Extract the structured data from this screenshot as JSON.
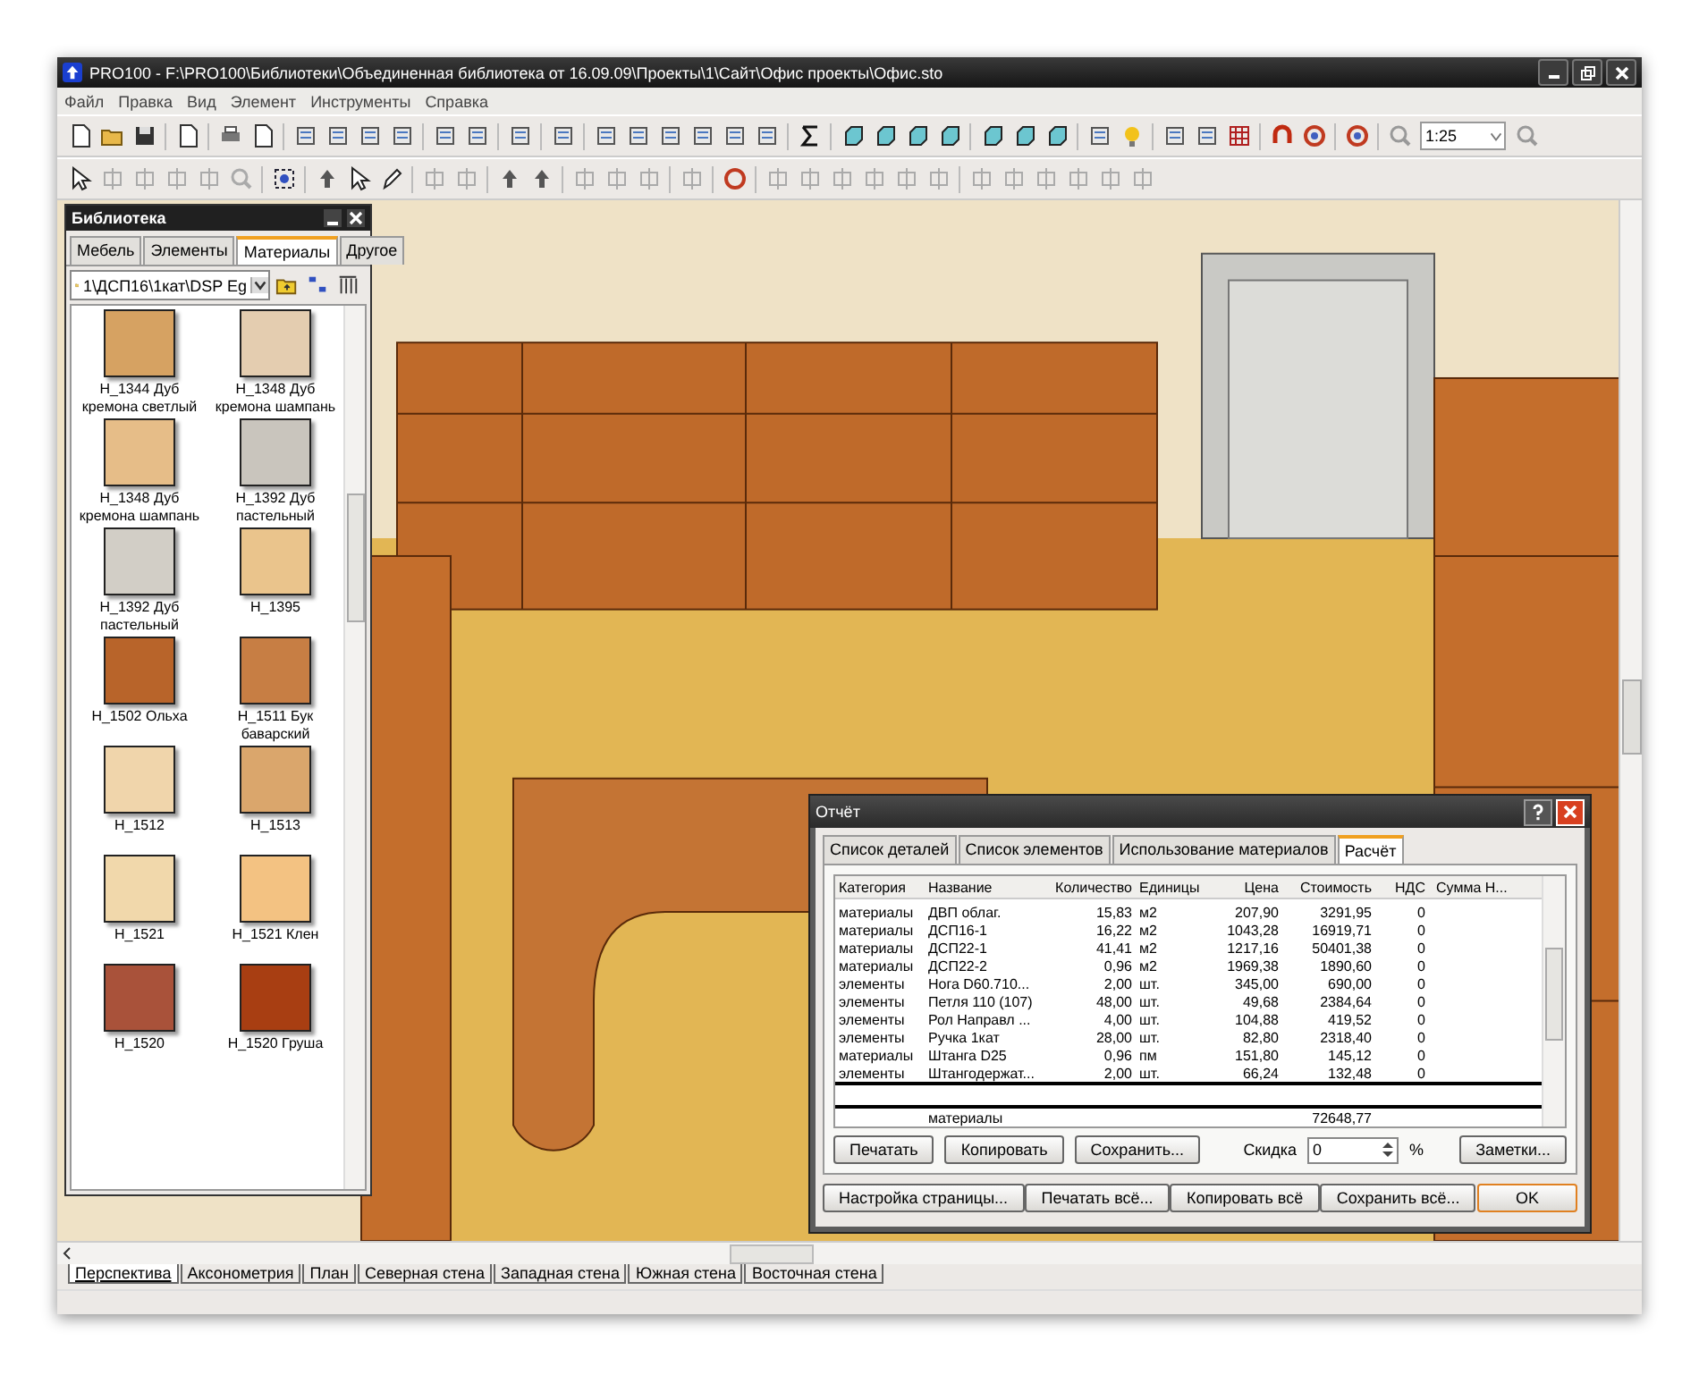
{
  "window": {
    "title": "PRO100 - F:\\PRO100\\Библиотеки\\Объединенная библиотека от 16.09.09\\Проекты\\1\\Сайт\\Офис проекты\\Офис.sto"
  },
  "menu": [
    "Файл",
    "Правка",
    "Вид",
    "Элемент",
    "Инструменты",
    "Справка"
  ],
  "toolbar": {
    "zoom": "1:25"
  },
  "library": {
    "title": "Библиотека",
    "tabs": [
      {
        "label": "Мебель",
        "selected": false
      },
      {
        "label": "Элементы",
        "selected": false
      },
      {
        "label": "Материалы",
        "selected": true
      },
      {
        "label": "Другое",
        "selected": false
      }
    ],
    "path": "1\\ДСП16\\1кат\\DSP Eg",
    "items": [
      {
        "label": "H_1344 Дуб кремона светлый",
        "color": "#d6a262"
      },
      {
        "label": "H_1348 Дуб кремона шампань",
        "color": "#e4cdb0"
      },
      {
        "label": "H_1348 Дуб кремона шампань",
        "color": "#e6bd88"
      },
      {
        "label": "H_1392 Дуб пастельный",
        "color": "#c9c5bd"
      },
      {
        "label": "H_1392 Дуб пастельный",
        "color": "#d2cec6"
      },
      {
        "label": "H_1395",
        "color": "#eac48c"
      },
      {
        "label": "H_1502 Ольха",
        "color": "#b8642a"
      },
      {
        "label": "H_1511 Бук баварский",
        "color": "#c77e44"
      },
      {
        "label": "H_1512",
        "color": "#f0d5ab"
      },
      {
        "label": "H_1513",
        "color": "#daa66c"
      },
      {
        "label": "H_1521",
        "color": "#f1d8ab"
      },
      {
        "label": "H_1521 Клен",
        "color": "#f3c282"
      },
      {
        "label": "H_1520",
        "color": "#a9523a"
      },
      {
        "label": "H_1520 Груша",
        "color": "#a83e12"
      }
    ]
  },
  "report": {
    "title": "Отчёт",
    "tabs": [
      {
        "label": "Список деталей",
        "selected": false
      },
      {
        "label": "Список элементов",
        "selected": false
      },
      {
        "label": "Использование материалов",
        "selected": false
      },
      {
        "label": "Расчёт",
        "selected": true
      }
    ],
    "columns": [
      "Категория",
      "Название",
      "Количество",
      "Единицы",
      "Цена",
      "Стоимость",
      "НДС",
      "Сумма Н..."
    ],
    "rows": [
      [
        "материалы",
        "ДВП облаг.",
        "15,83",
        "м2",
        "207,90",
        "3291,95",
        "0"
      ],
      [
        "материалы",
        "ДСП16-1",
        "16,22",
        "м2",
        "1043,28",
        "16919,71",
        "0"
      ],
      [
        "материалы",
        "ДСП22-1",
        "41,41",
        "м2",
        "1217,16",
        "50401,38",
        "0"
      ],
      [
        "материалы",
        "ДСП22-2",
        "0,96",
        "м2",
        "1969,38",
        "1890,60",
        "0"
      ],
      [
        "элементы",
        "Нога D60.710...",
        "2,00",
        "шт.",
        "345,00",
        "690,00",
        "0"
      ],
      [
        "элементы",
        "Петля 110 (107)",
        "48,00",
        "шт.",
        "49,68",
        "2384,64",
        "0"
      ],
      [
        "элементы",
        "Рол Направл ...",
        "4,00",
        "шт.",
        "104,88",
        "419,52",
        "0"
      ],
      [
        "элементы",
        "Ручка 1кат",
        "28,00",
        "шт.",
        "82,80",
        "2318,40",
        "0"
      ],
      [
        "материалы",
        "Штанга D25",
        "0,96",
        "пм",
        "151,80",
        "145,12",
        "0"
      ],
      [
        "элементы",
        "Штангодержат...",
        "2,00",
        "шт.",
        "66,24",
        "132,48",
        "0"
      ]
    ],
    "total": {
      "label": "материалы",
      "value": "72648,77"
    },
    "buttons": [
      "Печатать",
      "Копировать",
      "Сохранить..."
    ],
    "discount": {
      "label": "Скидка",
      "value": "0",
      "unit": "%"
    },
    "notes_button": "Заметки...",
    "footer_buttons": [
      {
        "label": "Настройка страницы...",
        "default": false
      },
      {
        "label": "Печатать всё...",
        "default": false
      },
      {
        "label": "Копировать всё",
        "default": false
      },
      {
        "label": "Сохранить всё...",
        "default": false
      },
      {
        "label": "OK",
        "default": true
      }
    ]
  },
  "view_tabs": [
    {
      "label": "Перспектива",
      "selected": true
    },
    {
      "label": "Аксонометрия",
      "selected": false
    },
    {
      "label": "План",
      "selected": false
    },
    {
      "label": "Северная стена",
      "selected": false
    },
    {
      "label": "Западная стена",
      "selected": false
    },
    {
      "label": "Южная стена",
      "selected": false
    },
    {
      "label": "Восточная стена",
      "selected": false
    }
  ]
}
